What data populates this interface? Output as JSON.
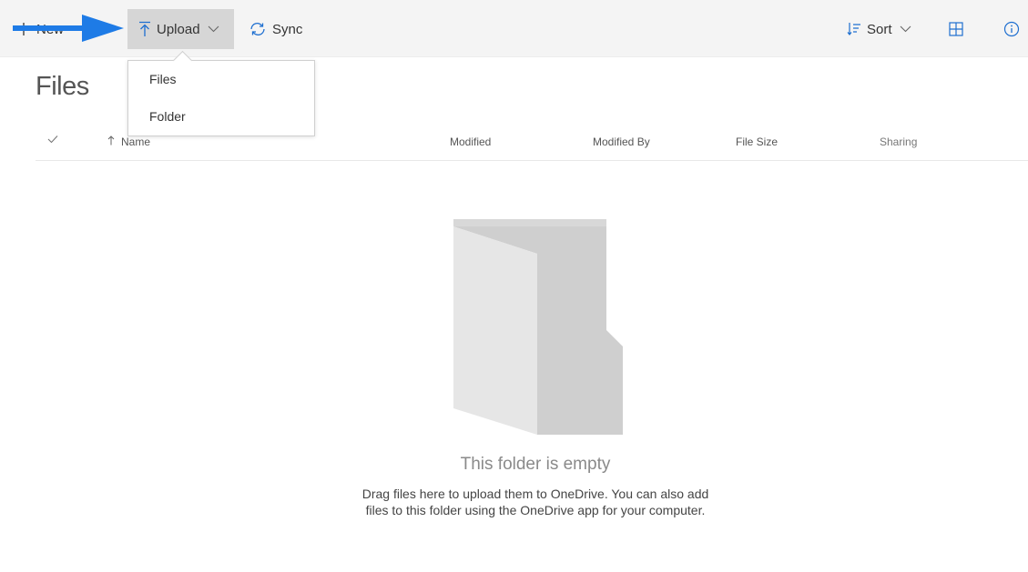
{
  "toolbar": {
    "new_label": "New",
    "upload_label": "Upload",
    "sync_label": "Sync",
    "sort_label": "Sort"
  },
  "upload_menu": {
    "items": [
      {
        "label": "Files"
      },
      {
        "label": "Folder"
      }
    ]
  },
  "page": {
    "title": "Files"
  },
  "table": {
    "columns": [
      "Name",
      "Modified",
      "Modified By",
      "File Size",
      "Sharing"
    ]
  },
  "empty_state": {
    "title": "This folder is empty",
    "line1": "Drag files here to upload them to OneDrive. You can also add",
    "line2": "files to this folder using the OneDrive app for your computer."
  },
  "colors": {
    "accent_arrow": "#1e7be6",
    "toolbar_bg": "#f4f4f4",
    "upload_active_bg": "#d6d6d6",
    "folder_gray_light": "#e6e6e6",
    "folder_gray_dark": "#cfcfcf"
  },
  "icons": {
    "new": "plus-icon",
    "upload": "upload-arrow-icon",
    "sync": "sync-icon",
    "sort": "sort-icon",
    "view": "grid-view-icon",
    "info": "info-icon",
    "checkmark": "checkmark-icon",
    "sort_direction": "arrow-up-icon",
    "empty_folder": "empty-folder-icon"
  }
}
